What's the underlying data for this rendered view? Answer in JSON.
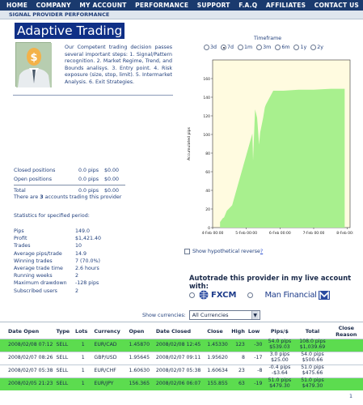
{
  "nav": {
    "items": [
      "HOME",
      "COMPANY",
      "MY ACCOUNT",
      "PERFORMANCE",
      "SUPPORT",
      "F.A.Q",
      "AFFILIATES",
      "CONTACT US"
    ]
  },
  "section_title": "SIGNAL PROVIDER PERFORMANCE",
  "provider": {
    "name": "Adaptive Trading",
    "description": "Our Competent trading decision passes several important steps: 1. Signal/Pattern recognition. 2. Market Regime, Trend, and Bounds analisys. 3. Entry point. 4. Risk exposure (size, stop, limit). 5. Intermarket Analysis. 6. Exit Strategies."
  },
  "positions": [
    {
      "label": "Closed positions",
      "pips": "0.0 pips",
      "usd": "$0.00"
    },
    {
      "label": "Open positions",
      "pips": "0.0 pips",
      "usd": "$0.00"
    },
    {
      "label": "Total",
      "pips": "0.0 pips",
      "usd": "$0.00"
    }
  ],
  "traders": {
    "prefix": "There are ",
    "count": "3",
    "suffix": " accounts trading this provider"
  },
  "stats_title": "Statistics for specified period:",
  "stats": [
    {
      "label": "Pips",
      "value": "149.0"
    },
    {
      "label": "Profit",
      "value": "$1,421.40"
    },
    {
      "label": "Trades",
      "value": "10"
    },
    {
      "label": "Average pips/trade",
      "value": "14.9"
    },
    {
      "label": "Winning trades",
      "value": "7 (70.0%)"
    },
    {
      "label": "Average trade time",
      "value": "2.6 hours"
    },
    {
      "label": "Running weeks",
      "value": "2"
    },
    {
      "label": "Maximum drawdown",
      "value": "-128 pips"
    },
    {
      "label": "Subscribed users",
      "value": "2"
    }
  ],
  "timeframe": {
    "label": "Timeframe",
    "options": [
      "3d",
      "7d",
      "1m",
      "3m",
      "6m",
      "1y",
      "2y"
    ],
    "selected": "7d"
  },
  "chart_data": {
    "type": "area",
    "ylabel": "Accumulated pips",
    "ylim": [
      0,
      180
    ],
    "yticks": [
      0,
      20,
      40,
      60,
      80,
      100,
      120,
      140,
      160
    ],
    "xticks": [
      "4-Feb 00:00",
      "5-Feb 00:00",
      "6-Feb 00:00",
      "7-Feb 00:00",
      "8-Feb 00:00"
    ],
    "xlim": [
      0,
      4.08
    ],
    "series": [
      {
        "x": [
          0.22,
          0.3,
          0.34,
          0.42,
          0.58,
          1.18,
          1.2,
          1.26,
          1.32,
          1.38,
          1.41,
          1.5,
          1.55,
          1.58,
          1.8,
          2.1,
          2.55,
          3.0,
          3.5,
          3.92
        ],
        "y": [
          6,
          10,
          11,
          18,
          24,
          101,
          72,
          127,
          118,
          89,
          102,
          118,
          129,
          132,
          147,
          147,
          148,
          148,
          149,
          149
        ]
      }
    ],
    "fill_color": "#a8f08e",
    "plot_bg": "#fffbe0"
  },
  "show_reverse": "Show hypothetical reverse",
  "reverse_q": "?",
  "autotrade": "Autotrade this provider in my live account with:",
  "brokers": {
    "fxcm": "FXCM",
    "manfin": "Man Financial"
  },
  "show_currencies": {
    "label": "Show currencies:",
    "value": "All Currencies"
  },
  "table": {
    "headers": [
      "Date Open",
      "Type",
      "Lots",
      "Currency",
      "Open",
      "Date Closed",
      "Close",
      "High",
      "Low",
      "Pips/$",
      "Total",
      "Close Reason"
    ],
    "rows": [
      {
        "date_open": "2008/02/08 07:12",
        "type": "SELL",
        "lots": "1",
        "currency": "EUR/CAD",
        "open": "1.45870",
        "date_closed": "2008/02/08 12:45",
        "close": "1.45330",
        "high": "123",
        "low": "-30",
        "pips": "54.0 pips",
        "usd": "$539.03",
        "total_pips": "108.0 pips",
        "total_usd": "$1,039.69",
        "reason": "",
        "hl": true
      },
      {
        "date_open": "2008/02/07 08:26",
        "type": "SELL",
        "lots": "1",
        "currency": "GBP/USD",
        "open": "1.95645",
        "date_closed": "2008/02/07 09:11",
        "close": "1.95620",
        "high": "8",
        "low": "-17",
        "pips": "3.0 pips",
        "usd": "$25.00",
        "total_pips": "54.0 pips",
        "total_usd": "$500.66",
        "reason": "",
        "hl": false
      },
      {
        "date_open": "2008/02/07 05:38",
        "type": "SELL",
        "lots": "1",
        "currency": "EUR/CHF",
        "open": "1.60630",
        "date_closed": "2008/02/07 05:38",
        "close": "1.60634",
        "high": "23",
        "low": "-8",
        "pips": "-0.4 pips",
        "usd": "-$3.64",
        "total_pips": "51.0 pips",
        "total_usd": "$475.66",
        "reason": "",
        "hl": false
      },
      {
        "date_open": "2008/02/05 21:23",
        "type": "SELL",
        "lots": "1",
        "currency": "EUR/JPY",
        "open": "156.365",
        "date_closed": "2008/02/06 06:07",
        "close": "155.855",
        "high": "63",
        "low": "-19",
        "pips": "51.0 pips",
        "usd": "$479.30",
        "total_pips": "51.0 pips",
        "total_usd": "$479.30",
        "reason": "",
        "hl": true
      }
    ]
  },
  "pager": "1"
}
